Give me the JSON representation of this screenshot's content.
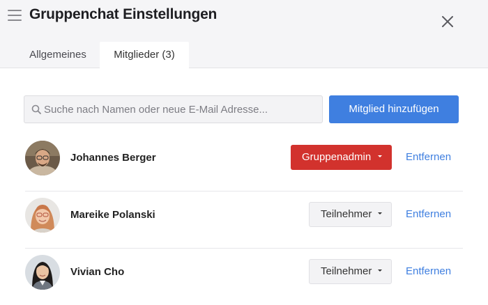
{
  "header": {
    "title": "Gruppenchat Einstellungen",
    "menu_icon": "hamburger-icon",
    "close_icon": "close-icon"
  },
  "tabs": [
    {
      "label": "Allgemeines",
      "active": false
    },
    {
      "label": "Mitglieder (3)",
      "active": true
    }
  ],
  "search": {
    "placeholder": "Suche nach Namen oder neue E-Mail Adresse...",
    "value": "",
    "icon": "search-icon"
  },
  "add_button": {
    "label": "Mitglied hinzufügen"
  },
  "members": [
    {
      "name": "Johannes Berger",
      "role": "Gruppenadmin",
      "remove_label": "Entfernen"
    },
    {
      "name": "Mareike Polanski",
      "role": "Teilnehmer",
      "remove_label": "Entfernen"
    },
    {
      "name": "Vivian Cho",
      "role": "Teilnehmer",
      "remove_label": "Entfernen"
    }
  ],
  "colors": {
    "accent": "#3f7fe0",
    "admin_red": "#d2322d",
    "header_bg": "#f5f5f7"
  }
}
